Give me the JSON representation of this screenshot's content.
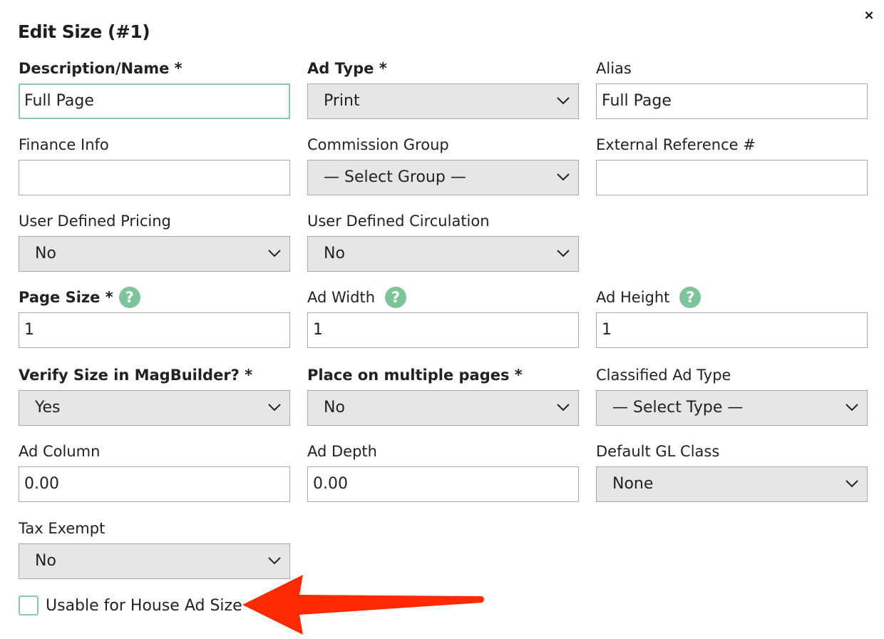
{
  "dialog": {
    "title": "Edit Size (#1)",
    "close_label": "×"
  },
  "fields": {
    "description": {
      "label": "Description/Name *",
      "value": "Full Page"
    },
    "ad_type": {
      "label": "Ad Type *",
      "value": "Print"
    },
    "alias": {
      "label": "Alias",
      "value": "Full Page"
    },
    "finance_info": {
      "label": "Finance Info",
      "value": ""
    },
    "commission_group": {
      "label": "Commission Group",
      "value": "— Select Group —"
    },
    "external_ref": {
      "label": "External Reference #",
      "value": ""
    },
    "user_pricing": {
      "label": "User Defined Pricing",
      "value": "No"
    },
    "user_circulation": {
      "label": "User Defined Circulation",
      "value": "No"
    },
    "page_size": {
      "label": "Page Size *",
      "value": "1"
    },
    "ad_width": {
      "label": "Ad Width",
      "value": "1"
    },
    "ad_height": {
      "label": "Ad Height",
      "value": "1"
    },
    "verify_size": {
      "label": "Verify Size in MagBuilder? *",
      "value": "Yes"
    },
    "multiple_pages": {
      "label": "Place on multiple pages *",
      "value": "No"
    },
    "classified_type": {
      "label": "Classified Ad Type",
      "value": "— Select Type —"
    },
    "ad_column": {
      "label": "Ad Column",
      "value": "0.00"
    },
    "ad_depth": {
      "label": "Ad Depth",
      "value": "0.00"
    },
    "gl_class": {
      "label": "Default GL Class",
      "value": "None"
    },
    "tax_exempt": {
      "label": "Tax Exempt",
      "value": "No"
    }
  },
  "house_ad": {
    "label": "Usable for House Ad Size",
    "checked": false
  },
  "help_glyph": "?",
  "colors": {
    "accent": "#7dc49a",
    "focus_border": "#8ccaa6",
    "select_bg": "#e6e6e6",
    "annotation_arrow": "#ff2a00"
  }
}
